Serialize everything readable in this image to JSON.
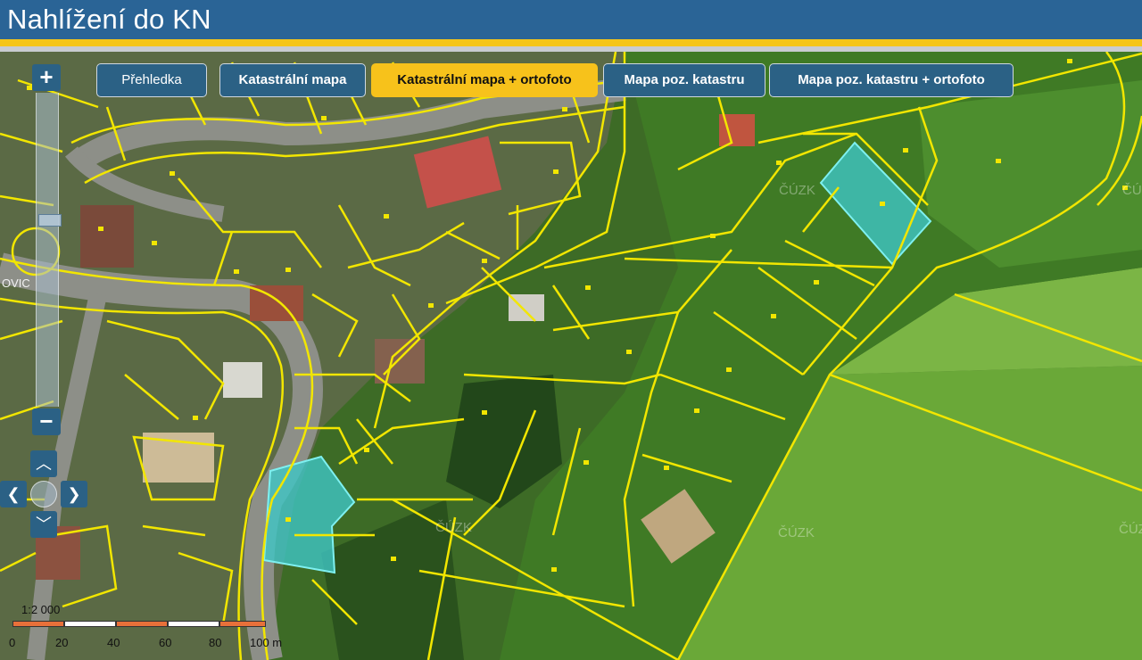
{
  "header": {
    "title": "Nahlížení do KN"
  },
  "tabs": [
    {
      "label": "Přehledka",
      "active": false
    },
    {
      "label": "Katastrální mapa",
      "active": false
    },
    {
      "label": "Katastrální mapa + ortofoto",
      "active": true
    },
    {
      "label": "Mapa poz. katastru",
      "active": false
    },
    {
      "label": "Mapa poz. katastru + ortofoto",
      "active": false
    }
  ],
  "zoom": {
    "in_label": "+",
    "out_label": "−"
  },
  "pan": {
    "up": "︿",
    "down": "﹀",
    "left": "❮",
    "right": "❯"
  },
  "map": {
    "watermark": "ČÚZK",
    "place_fragment": "OVIC",
    "colors": {
      "parcel_line": "#f2e600",
      "selected_fill": "#3fc6c6",
      "meadow": "#4e8a2a",
      "field": "#6fae3a"
    }
  },
  "scale": {
    "ratio": "1:2 000",
    "labels": [
      "0",
      "20",
      "40",
      "60",
      "80",
      "100 m"
    ]
  },
  "icons": [
    "plus-icon",
    "minus-icon",
    "arrow-up-icon",
    "arrow-down-icon",
    "arrow-left-icon",
    "arrow-right-icon"
  ]
}
